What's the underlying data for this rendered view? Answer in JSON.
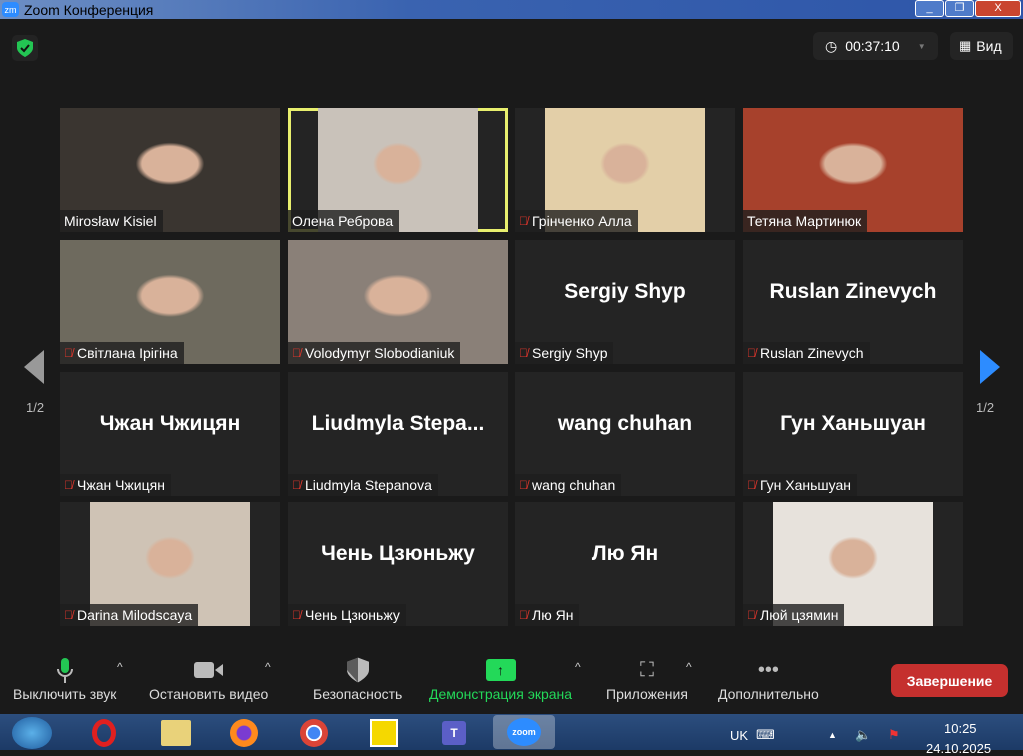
{
  "window": {
    "title": "Zoom Конференция",
    "logo": "zm",
    "buttons": [
      "_",
      "❐",
      "X"
    ]
  },
  "header": {
    "timer": "00:37:10",
    "view_label": "Вид"
  },
  "pagination": {
    "left": "1/2",
    "right": "1/2"
  },
  "tiles": [
    {
      "name": "Mirosław Kisiel",
      "muted": false,
      "video": true,
      "bg": "#3a3530"
    },
    {
      "name": "Олена Реброва",
      "muted": false,
      "video": true,
      "active": true,
      "bg": "#c9c2ba"
    },
    {
      "name": "Грінченко Алла",
      "muted": true,
      "video": true,
      "bg": "#e3cfa8"
    },
    {
      "name": "Тетяна Мартинюк",
      "muted": false,
      "video": true,
      "bg": "#a7412c"
    },
    {
      "name": "Світлана Ірігіна",
      "muted": true,
      "video": true,
      "bg": "#6e6a5e"
    },
    {
      "name": "Volodymyr Slobodianiuk",
      "muted": true,
      "video": true,
      "bg": "#8a8078"
    },
    {
      "name": "Sergiy Shyp",
      "big": "Sergiy Shyp",
      "muted": true
    },
    {
      "name": "Ruslan Zinevych",
      "big": "Ruslan Zinevych",
      "muted": true
    },
    {
      "name": "Чжан Чжицян",
      "big": "Чжан Чжицян",
      "muted": true
    },
    {
      "name": "Liudmyla Stepanova",
      "big": "Liudmyla  Stepa...",
      "muted": true
    },
    {
      "name": "wang chuhan",
      "big": "wang chuhan",
      "muted": true
    },
    {
      "name": "Гун Ханьшуан",
      "big": "Гун Ханьшуан",
      "muted": true
    },
    {
      "name": "Darina Milodscaya",
      "muted": true,
      "video": true,
      "bg": "#cfc3b5"
    },
    {
      "name": "Чень Цзюньжу",
      "big": "Чень Цзюньжу",
      "muted": true
    },
    {
      "name": "Лю Ян",
      "big": "Лю Ян",
      "muted": true
    },
    {
      "name": "Люй цзямин",
      "muted": true,
      "video": true,
      "bg": "#e7e2dc"
    }
  ],
  "toolbar": {
    "mute": "Выключить звук",
    "video": "Остановить видео",
    "security": "Безопасность",
    "share": "Демонстрация экрана",
    "apps": "Приложения",
    "more": "Дополнительно",
    "end": "Завершение"
  },
  "taskbar": {
    "lang": "UK",
    "time": "10:25",
    "date": "24.10.2025",
    "zoom_label": "zoom"
  },
  "colors": {
    "share": "#23d959",
    "end": "#c5302e",
    "active_border": "#e8ef6e"
  }
}
